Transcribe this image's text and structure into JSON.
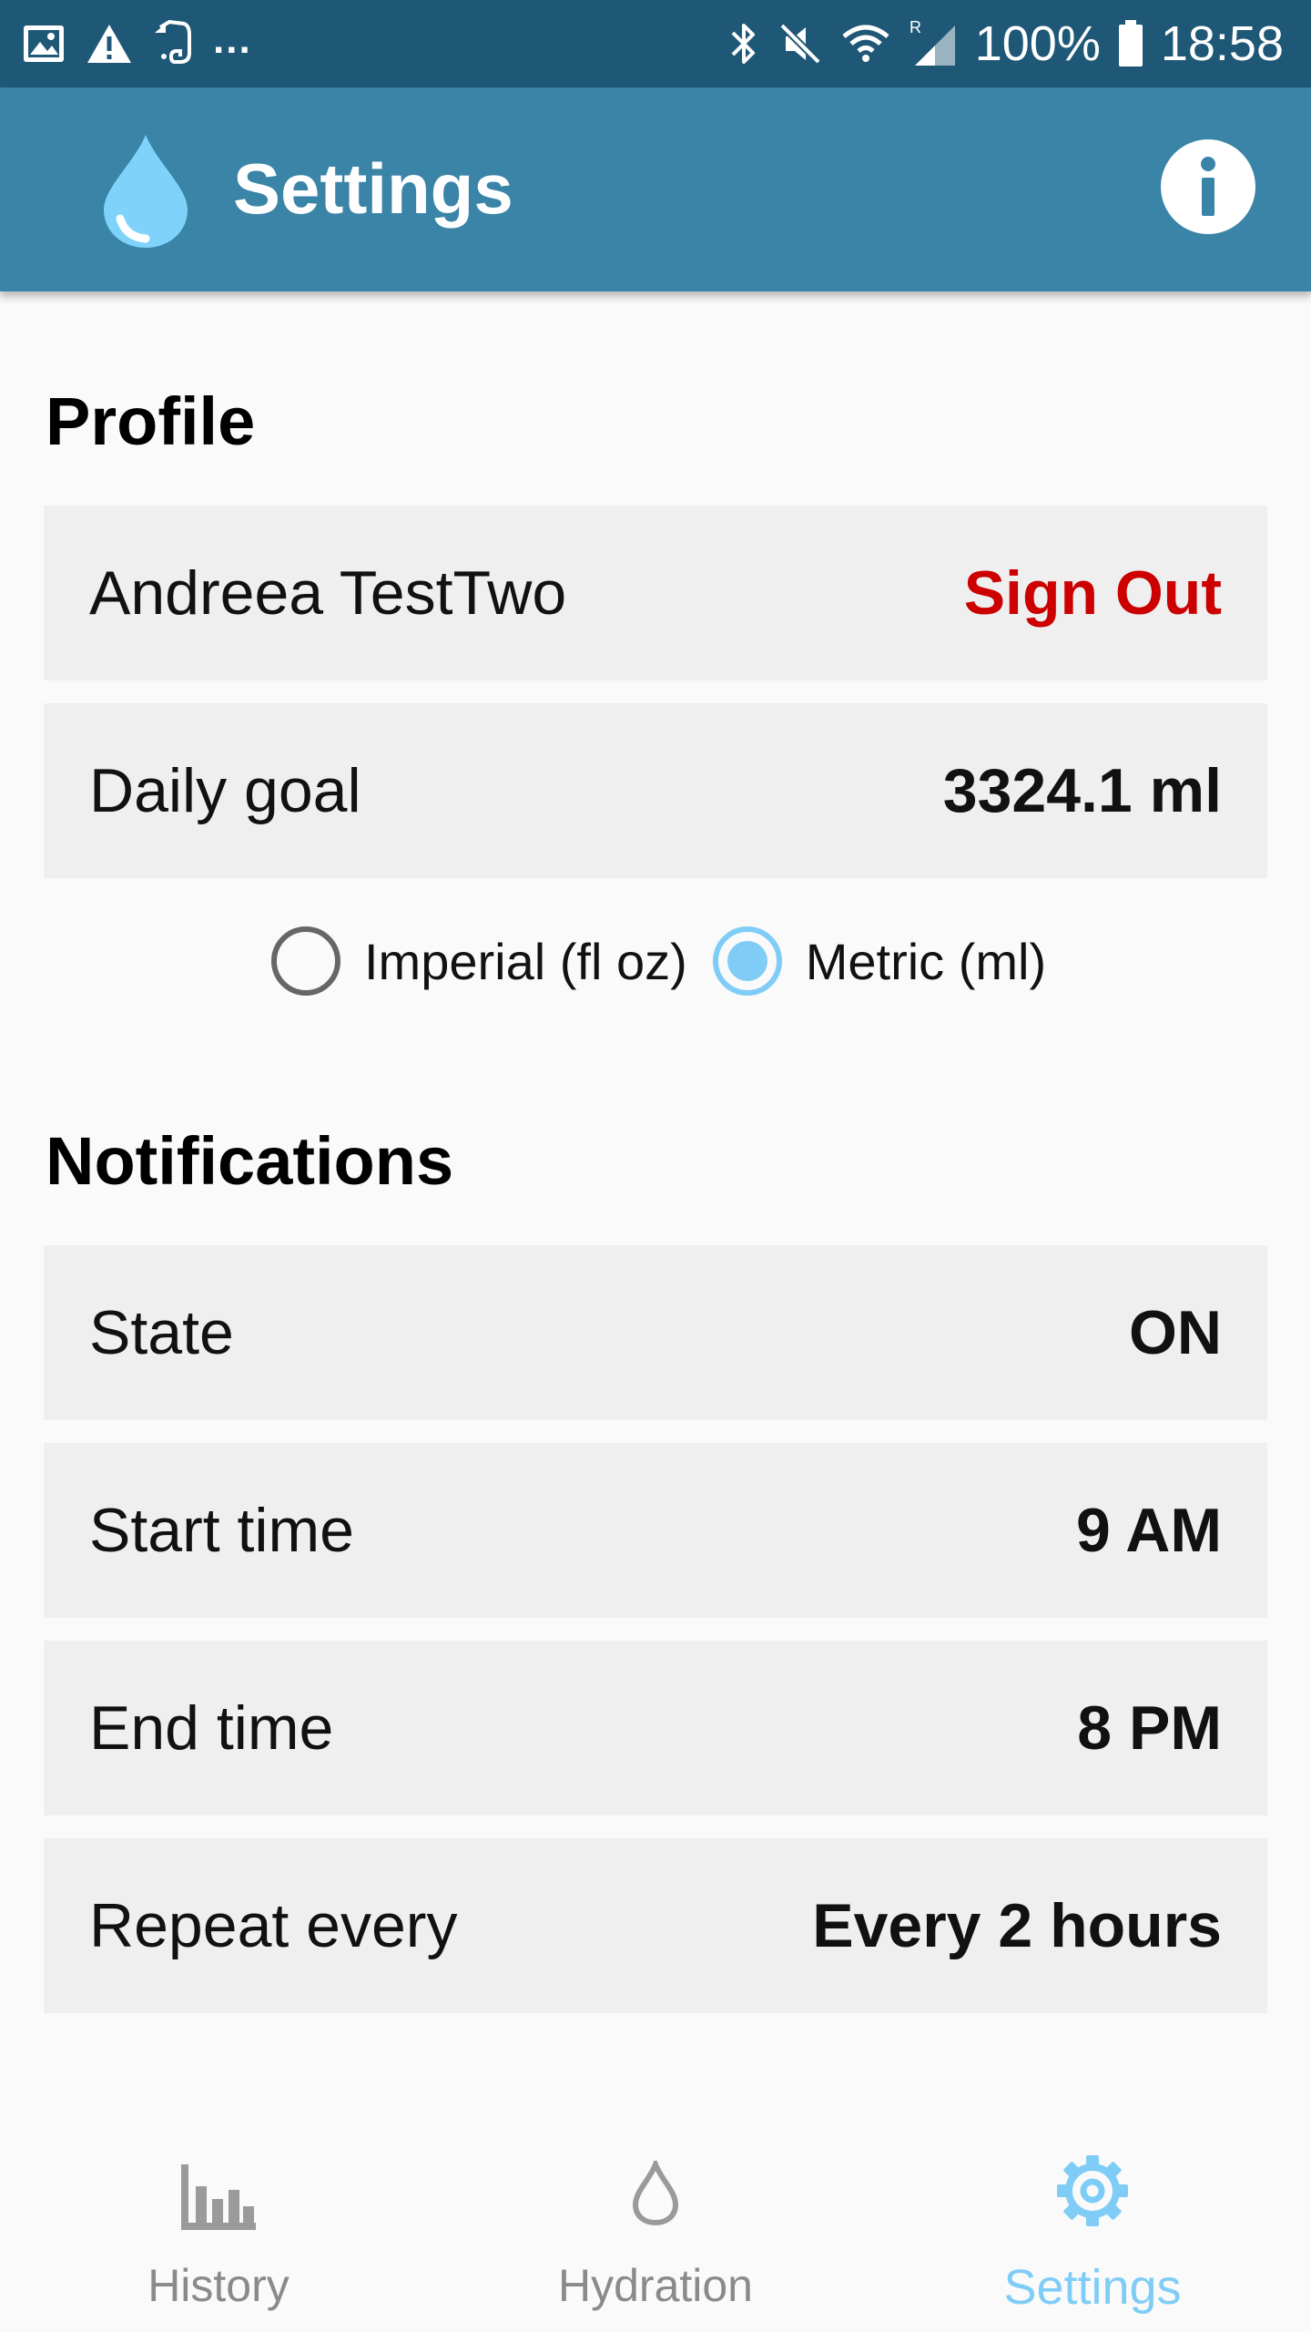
{
  "status_bar": {
    "battery_percent": "100%",
    "time": "18:58",
    "more_indicator": "...",
    "roaming": "R",
    "icons": [
      "gallery-icon",
      "warning-icon",
      "evernote-icon",
      "bluetooth-icon",
      "mute-icon",
      "wifi-icon",
      "signal-icon",
      "battery-icon"
    ]
  },
  "app_bar": {
    "title": "Settings",
    "logo_icon": "water-drop-icon",
    "info_icon": "info-icon",
    "color": "#3a84a8"
  },
  "profile": {
    "section_title": "Profile",
    "user_name": "Andreea TestTwo",
    "sign_out_label": "Sign Out",
    "daily_goal_label": "Daily goal",
    "daily_goal_value": "3324.1 ml",
    "units": {
      "options": [
        "Imperial (fl oz)",
        "Metric (ml)"
      ],
      "selected": "Metric (ml)"
    }
  },
  "notifications": {
    "section_title": "Notifications",
    "rows": [
      {
        "label": "State",
        "value": "ON"
      },
      {
        "label": "Start time",
        "value": "9 AM"
      },
      {
        "label": "End time",
        "value": "8 PM"
      },
      {
        "label": "Repeat every",
        "value": "Every 2 hours"
      }
    ]
  },
  "bottom_nav": {
    "items": [
      {
        "label": "History",
        "icon": "bar-chart-icon",
        "active": false
      },
      {
        "label": "Hydration",
        "icon": "water-drop-outline-icon",
        "active": false
      },
      {
        "label": "Settings",
        "icon": "gear-icon",
        "active": true
      }
    ]
  },
  "colors": {
    "sign_out": "#cc0000",
    "accent": "#7fcdf6",
    "status_bar": "#1f5876"
  }
}
